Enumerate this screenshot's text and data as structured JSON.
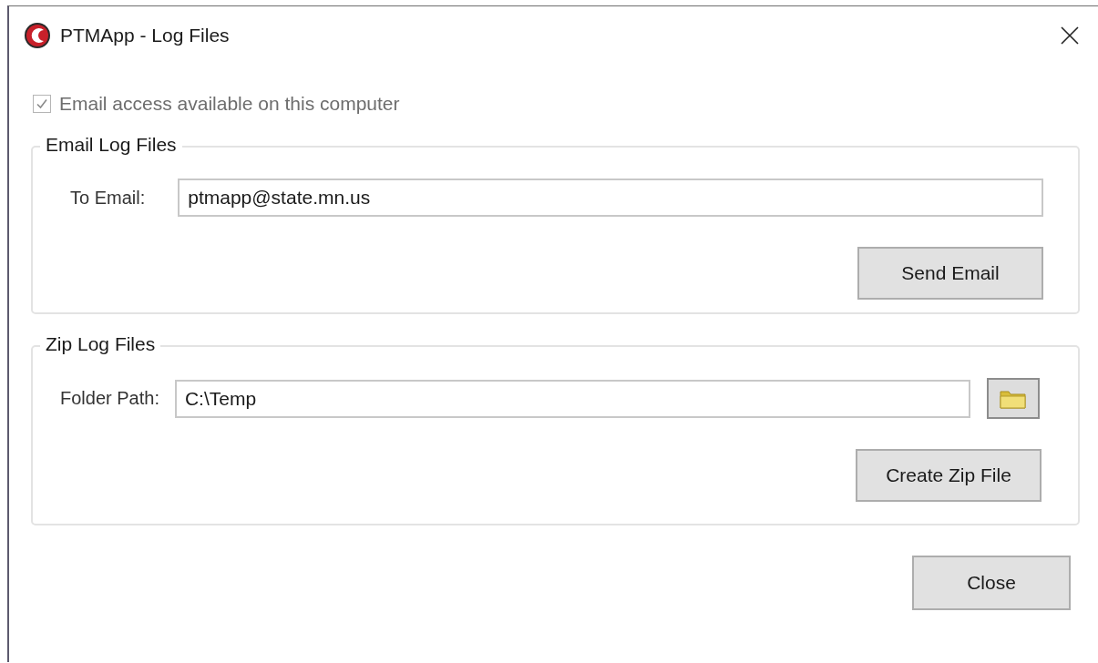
{
  "window": {
    "title": "PTMApp - Log Files"
  },
  "email_access": {
    "label": "Email access available on this computer",
    "checked": true,
    "disabled": true
  },
  "email_group": {
    "title": "Email Log Files",
    "field_label": "To Email:",
    "value": "ptmapp@state.mn.us",
    "button": "Send Email"
  },
  "zip_group": {
    "title": "Zip Log Files",
    "field_label": "Folder Path:",
    "value": "C:\\Temp",
    "button": "Create Zip File"
  },
  "buttons": [
    "Close"
  ]
}
